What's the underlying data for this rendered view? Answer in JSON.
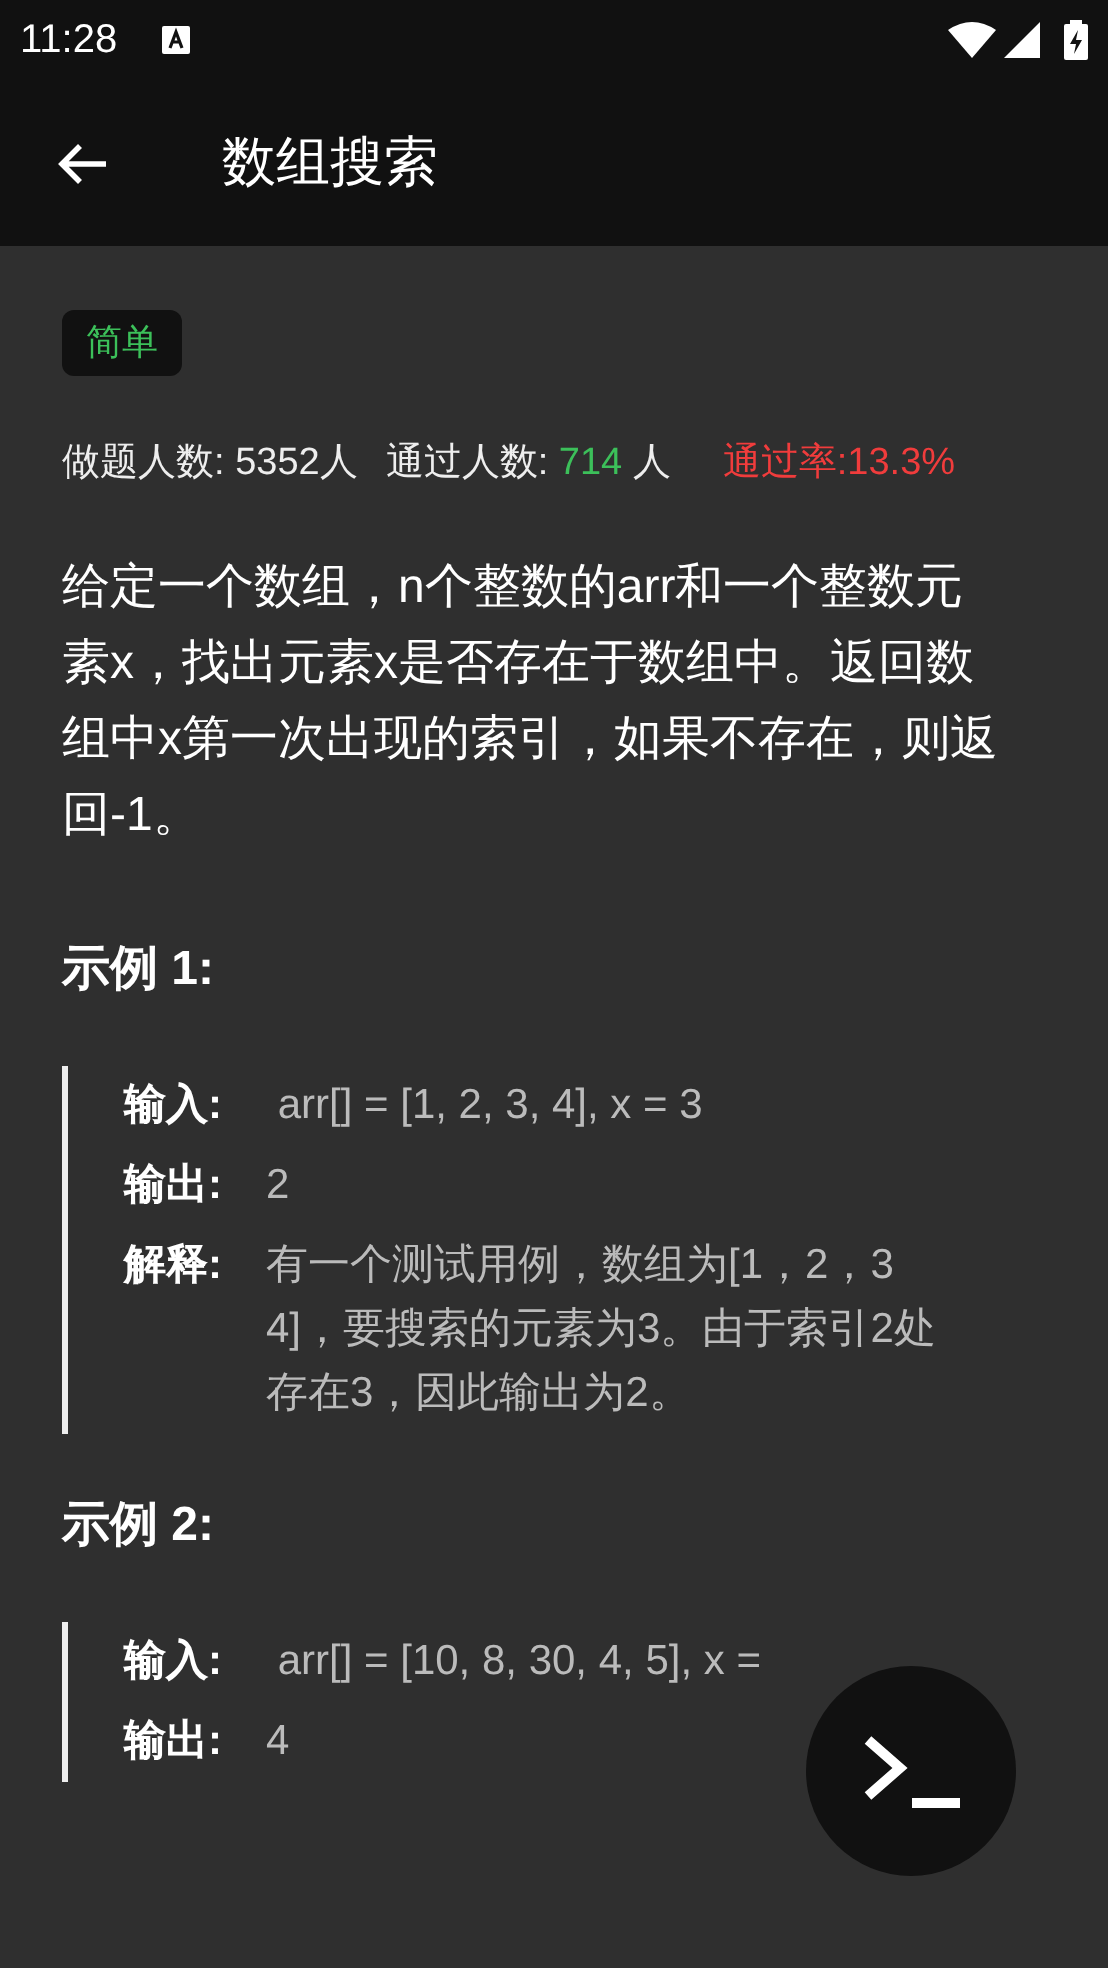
{
  "status_bar": {
    "time": "11:28"
  },
  "app_bar": {
    "title": "数组搜索"
  },
  "difficulty": {
    "label": "简单"
  },
  "stats": [
    {
      "label": "做题人数:",
      "value": "5352",
      "unit": "人",
      "kind": "plain"
    },
    {
      "label": "通过人数:",
      "value": "714",
      "unit": "人",
      "kind": "green"
    },
    {
      "label": "通过率:",
      "value": "13.3%",
      "kind": "red"
    }
  ],
  "description": "给定一个数组，n个整数的arr和一个整数元素x，找出元素x是否存在于数组中。返回数组中x第一次出现的索引，如果不存在，则返回-1。",
  "examples": [
    {
      "title": "示例 1:",
      "rows": [
        {
          "label": "输入:",
          "value": " arr[] = [1, 2, 3, 4], x = 3"
        },
        {
          "label": "输出:",
          "value": "2"
        },
        {
          "label": "解释:",
          "value": "有一个测试用例，数组为[1，2，3 4]，要搜索的元素为3。由于索引2处存在3，因此输出为2。"
        }
      ]
    },
    {
      "title": "示例 2:",
      "rows": [
        {
          "label": "输入:",
          "value": " arr[] = [10, 8, 30, 4, 5], x ="
        },
        {
          "label": "输出:",
          "value": "4"
        }
      ]
    }
  ]
}
